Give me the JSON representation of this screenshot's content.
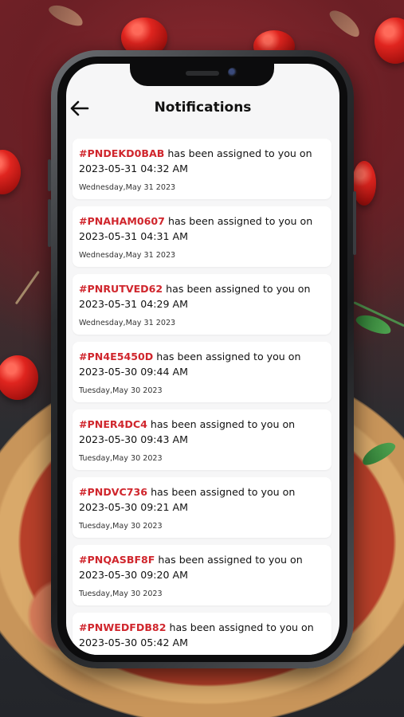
{
  "screen": {
    "title": "Notifications",
    "back_icon": "arrow-left-icon"
  },
  "colors": {
    "code": "#d0262d",
    "card": "#ffffff",
    "screen": "#f6f6f7"
  },
  "notifications": [
    {
      "code": "#PNDEKD0BAB",
      "text": " has been assigned to you on 2023-05-31 04:32 AM",
      "date": "Wednesday,May 31 2023"
    },
    {
      "code": "#PNAHAM0607",
      "text": " has been assigned to you on 2023-05-31 04:31 AM",
      "date": "Wednesday,May 31 2023"
    },
    {
      "code": "#PNRUTVED62",
      "text": " has been assigned to you on 2023-05-31 04:29 AM",
      "date": "Wednesday,May 31 2023"
    },
    {
      "code": "#PN4E5450D",
      "text": " has been assigned to you on 2023-05-30 09:44 AM",
      "date": "Tuesday,May 30 2023"
    },
    {
      "code": "#PNER4DC4",
      "text": " has been assigned to you on 2023-05-30 09:43 AM",
      "date": "Tuesday,May 30 2023"
    },
    {
      "code": "#PNDVC736",
      "text": " has been assigned to you on 2023-05-30 09:21 AM",
      "date": "Tuesday,May 30 2023"
    },
    {
      "code": "#PNQASBF8F",
      "text": " has been assigned to you on 2023-05-30 09:20 AM",
      "date": "Tuesday,May 30 2023"
    },
    {
      "code": "#PNWEDFDB82",
      "text": " has been assigned to you on 2023-05-30 05:42 AM",
      "date": ""
    }
  ]
}
